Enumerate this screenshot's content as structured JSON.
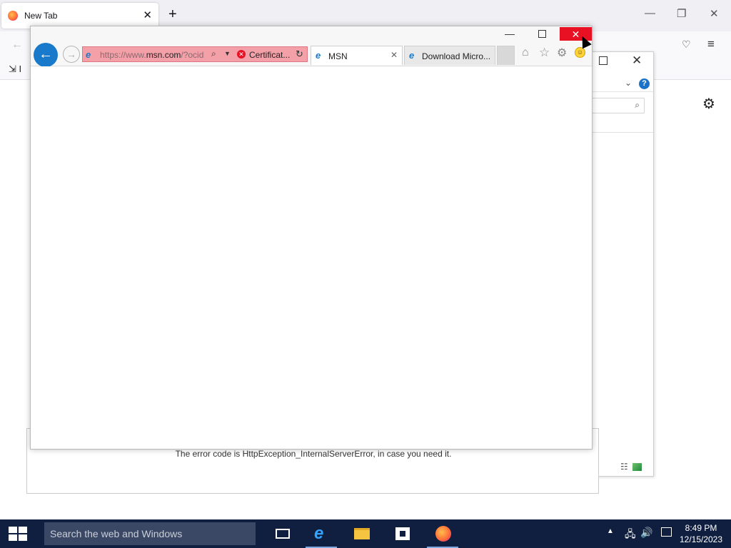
{
  "firefox": {
    "tab_title": "New Tab",
    "tab_close": "✕",
    "new_tab": "+",
    "minimize": "—",
    "restore": "❐",
    "close": "✕",
    "back": "←",
    "pocket": "♡",
    "menu": "≡",
    "import_label": "⇲ I",
    "settings": "⚙"
  },
  "bg_dialog": {
    "close": "✕",
    "chevron": "⌄",
    "help": "?",
    "search_icon": "⌕"
  },
  "error_panel": {
    "message": "The error code is HttpException_InternalServerError, in case you need it."
  },
  "ie": {
    "minimize": "—",
    "close": "✕",
    "back": "←",
    "forward": "→",
    "address": {
      "url_prefix": "https://www.",
      "url_domain": "msn.com",
      "url_suffix": "/?ocid",
      "search": "⌕",
      "dropdown": "▼",
      "cert_icon": "✕",
      "cert_label": "Certificat...",
      "refresh": "↻"
    },
    "tabs": [
      {
        "title": "MSN",
        "close": "✕"
      },
      {
        "title": "Download Micro..."
      }
    ],
    "home": "⌂",
    "favorites": "☆",
    "tools": "⚙",
    "feedback": "☺"
  },
  "taskbar": {
    "search_placeholder": "Search the web and Windows",
    "tray_chevron": "▲",
    "network": "🖧",
    "volume": "🔊",
    "time": "8:49 PM",
    "date": "12/15/2023"
  }
}
